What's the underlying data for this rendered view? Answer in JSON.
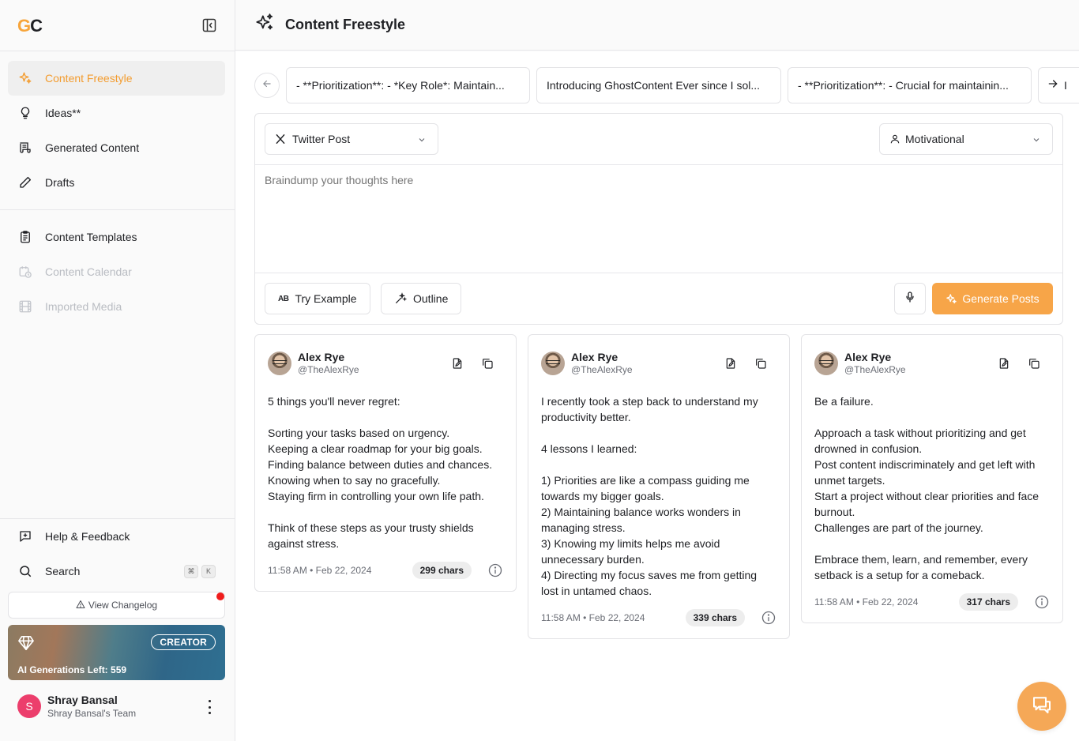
{
  "sidebar": {
    "logo": {
      "g": "G",
      "c": "C"
    },
    "nav_primary": [
      {
        "label": "Content Freestyle",
        "icon": "sparkle-icon",
        "active": true
      },
      {
        "label": "Ideas**",
        "icon": "lightbulb-icon"
      },
      {
        "label": "Generated Content",
        "icon": "scroll-icon"
      },
      {
        "label": "Drafts",
        "icon": "pencil-icon"
      }
    ],
    "nav_secondary": [
      {
        "label": "Content Templates",
        "icon": "clipboard-icon"
      },
      {
        "label": "Content Calendar",
        "icon": "calendar-clock-icon",
        "disabled": true
      },
      {
        "label": "Imported Media",
        "icon": "film-icon",
        "disabled": true
      }
    ],
    "help": {
      "label": "Help & Feedback",
      "icon": "message-plus-icon"
    },
    "search": {
      "label": "Search",
      "icon": "search-icon",
      "shortcut": [
        "⌘",
        "K"
      ]
    },
    "changelog": {
      "label": "View Changelog",
      "icon": "warning-icon",
      "has_notification": true
    },
    "plan": {
      "badge": "CREATOR",
      "generations": "AI Generations Left: 559",
      "icon": "diamond-icon"
    },
    "user": {
      "initial": "S",
      "name": "Shray Bansal",
      "team": "Shray Bansal's Team",
      "avatar_color": "#ec3e6c"
    }
  },
  "header": {
    "title": "Content Freestyle",
    "icon": "sparkles-icon"
  },
  "carousel": {
    "chips": [
      "- **Prioritization**: - *Key Role*: Maintain...",
      "Introducing GhostContent Ever since I sol...",
      "- **Prioritization**: - Crucial for maintainin..."
    ],
    "next_partial": "I"
  },
  "composer": {
    "platform": {
      "label": "Twitter Post",
      "icon": "x-logo-icon"
    },
    "tone": {
      "label": "Motivational",
      "icon": "user-icon"
    },
    "placeholder": "Braindump your thoughts here",
    "try_example": "Try Example",
    "outline": "Outline",
    "generate": "Generate Posts"
  },
  "posts": [
    {
      "name": "Alex Rye",
      "handle": "@TheAlexRye",
      "body": "5 things you'll never regret:\n\nSorting your tasks based on urgency.\nKeeping a clear roadmap for your big goals.\nFinding balance between duties and chances.\nKnowing when to say no gracefully.\nStaying firm in controlling your own life path.\n\nThink of these steps as your trusty shields against stress.",
      "time": "11:58 AM • Feb 22, 2024",
      "chars": "299 chars"
    },
    {
      "name": "Alex Rye",
      "handle": "@TheAlexRye",
      "body": "I recently took a step back to understand my productivity better.\n\n4 lessons I learned:\n\n1) Priorities are like a compass guiding me towards my bigger goals.\n2) Maintaining balance works wonders in managing stress.\n3) Knowing my limits helps me avoid unnecessary burden.\n4) Directing my focus saves me from getting lost in untamed chaos.",
      "time": "11:58 AM • Feb 22, 2024",
      "chars": "339 chars"
    },
    {
      "name": "Alex Rye",
      "handle": "@TheAlexRye",
      "body": "Be a failure.\n\nApproach a task without prioritizing and get drowned in confusion.\nPost content indiscriminately and get left with unmet targets.\nStart a project without clear priorities and face burnout.\nChallenges are part of the journey.\n\nEmbrace them, learn, and remember, every setback is a setup for a comeback.",
      "time": "11:58 AM • Feb 22, 2024",
      "chars": "317 chars"
    }
  ],
  "colors": {
    "accent": "#f39c2f",
    "generate_button": "#f7a548",
    "chat_bubble": "#f5a857"
  }
}
